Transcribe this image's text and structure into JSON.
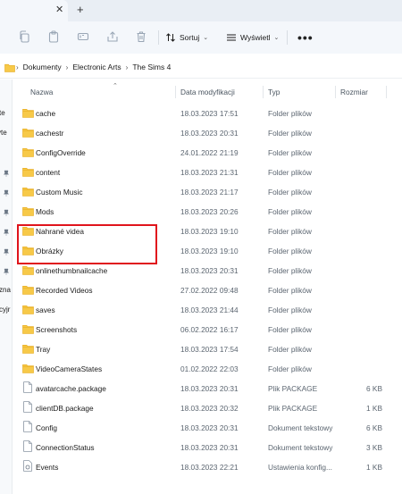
{
  "tab": {
    "close_glyph": "✕",
    "add_glyph": "+"
  },
  "toolbar": {
    "icons": [
      "copy-icon",
      "paste-icon",
      "rename-icon",
      "share-icon",
      "delete-icon"
    ],
    "sort_label": "Sortuj",
    "view_label": "Wyświetl",
    "more_label": "•••"
  },
  "breadcrumb": [
    "Dokumenty",
    "Electronic Arts",
    "The Sims 4"
  ],
  "nav": {
    "fragments": [
      "te",
      "yte",
      "zna",
      "cyjr"
    ]
  },
  "columns": {
    "name": "Nazwa",
    "date": "Data modyfikacji",
    "type": "Typ",
    "size": "Rozmiar"
  },
  "files": [
    {
      "name": "cache",
      "date": "18.03.2023 17:51",
      "type": "Folder plików",
      "size": "",
      "kind": "folder"
    },
    {
      "name": "cachestr",
      "date": "18.03.2023 20:31",
      "type": "Folder plików",
      "size": "",
      "kind": "folder"
    },
    {
      "name": "ConfigOverride",
      "date": "24.01.2022 21:19",
      "type": "Folder plików",
      "size": "",
      "kind": "folder"
    },
    {
      "name": "content",
      "date": "18.03.2023 21:31",
      "type": "Folder plików",
      "size": "",
      "kind": "folder"
    },
    {
      "name": "Custom Music",
      "date": "18.03.2023 21:17",
      "type": "Folder plików",
      "size": "",
      "kind": "folder"
    },
    {
      "name": "Mods",
      "date": "18.03.2023 20:26",
      "type": "Folder plików",
      "size": "",
      "kind": "folder"
    },
    {
      "name": "Nahrané videa",
      "date": "18.03.2023 19:10",
      "type": "Folder plików",
      "size": "",
      "kind": "folder"
    },
    {
      "name": "Obrázky",
      "date": "18.03.2023 19:10",
      "type": "Folder plików",
      "size": "",
      "kind": "folder"
    },
    {
      "name": "onlinethumbnailcache",
      "date": "18.03.2023 20:31",
      "type": "Folder plików",
      "size": "",
      "kind": "folder"
    },
    {
      "name": "Recorded Videos",
      "date": "27.02.2022 09:48",
      "type": "Folder plików",
      "size": "",
      "kind": "folder"
    },
    {
      "name": "saves",
      "date": "18.03.2023 21:44",
      "type": "Folder plików",
      "size": "",
      "kind": "folder"
    },
    {
      "name": "Screenshots",
      "date": "06.02.2022 16:17",
      "type": "Folder plików",
      "size": "",
      "kind": "folder"
    },
    {
      "name": "Tray",
      "date": "18.03.2023 17:54",
      "type": "Folder plików",
      "size": "",
      "kind": "folder"
    },
    {
      "name": "VideoCameraStates",
      "date": "01.02.2022 22:03",
      "type": "Folder plików",
      "size": "",
      "kind": "folder"
    },
    {
      "name": "avatarcache.package",
      "date": "18.03.2023 20:31",
      "type": "Plik PACKAGE",
      "size": "6 KB",
      "kind": "file"
    },
    {
      "name": "clientDB.package",
      "date": "18.03.2023 20:32",
      "type": "Plik PACKAGE",
      "size": "1 KB",
      "kind": "file"
    },
    {
      "name": "Config",
      "date": "18.03.2023 20:31",
      "type": "Dokument tekstowy",
      "size": "6 KB",
      "kind": "file"
    },
    {
      "name": "ConnectionStatus",
      "date": "18.03.2023 20:31",
      "type": "Dokument tekstowy",
      "size": "3 KB",
      "kind": "file"
    },
    {
      "name": "Events",
      "date": "18.03.2023 22:21",
      "type": "Ustawienia konfig...",
      "size": "1 KB",
      "kind": "file-settings"
    }
  ],
  "colors": {
    "folder": "#f7c948",
    "folder_dark": "#e5a91a",
    "highlight": "#e0141c",
    "accent": "#0067c0"
  }
}
